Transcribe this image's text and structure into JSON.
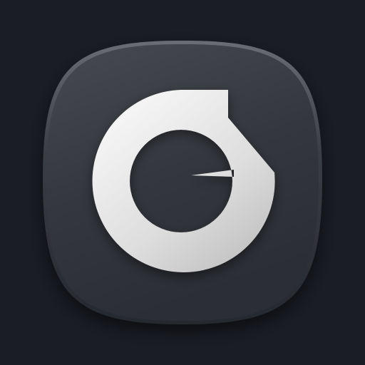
{
  "app_icon": {
    "glyph": "G",
    "icon": "g-logo-icon",
    "colors": {
      "background": "#1a1d24",
      "tile_top": "#474a50",
      "tile_bottom": "#2b2e34",
      "glyph_light": "#fafafa",
      "glyph_dark": "#bdbdbd"
    }
  }
}
